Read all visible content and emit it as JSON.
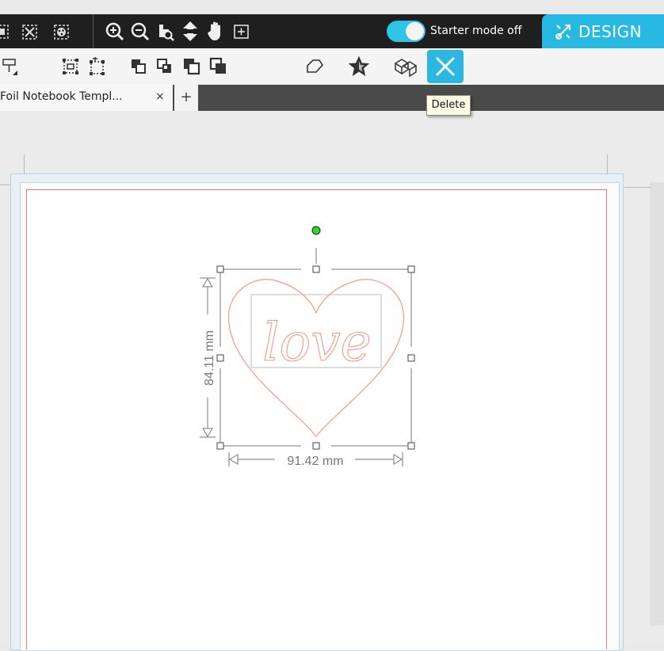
{
  "toolbar": {
    "starter_mode_label": "Starter mode off",
    "design_tab_label": "DESIGN",
    "accent_color": "#28b9e2"
  },
  "toolbar_icons": [
    "select-all-icon",
    "deselect-icon",
    "edit-points-icon",
    "zoom-in-icon",
    "zoom-out-icon",
    "zoom-to-selection-icon",
    "fit-to-page-icon",
    "pan-hand-icon",
    "add-page-icon"
  ],
  "arrange_icons": [
    "paint-bucket-icon",
    "group-icon",
    "ungroup-icon",
    "bring-forward-icon",
    "send-backward-icon",
    "bring-to-front-icon",
    "send-to-back-icon",
    "shape-icon",
    "star-icon",
    "3d-box-icon",
    "delete-icon"
  ],
  "document_tab": {
    "title": "Foil Notebook Templ...",
    "close": "×",
    "add": "+"
  },
  "tooltip": "Delete",
  "selection": {
    "width_label": "91.42 mm",
    "height_label": "84.11 mm",
    "text": "love",
    "shape": "heart",
    "stroke_color": "#f29a86"
  }
}
